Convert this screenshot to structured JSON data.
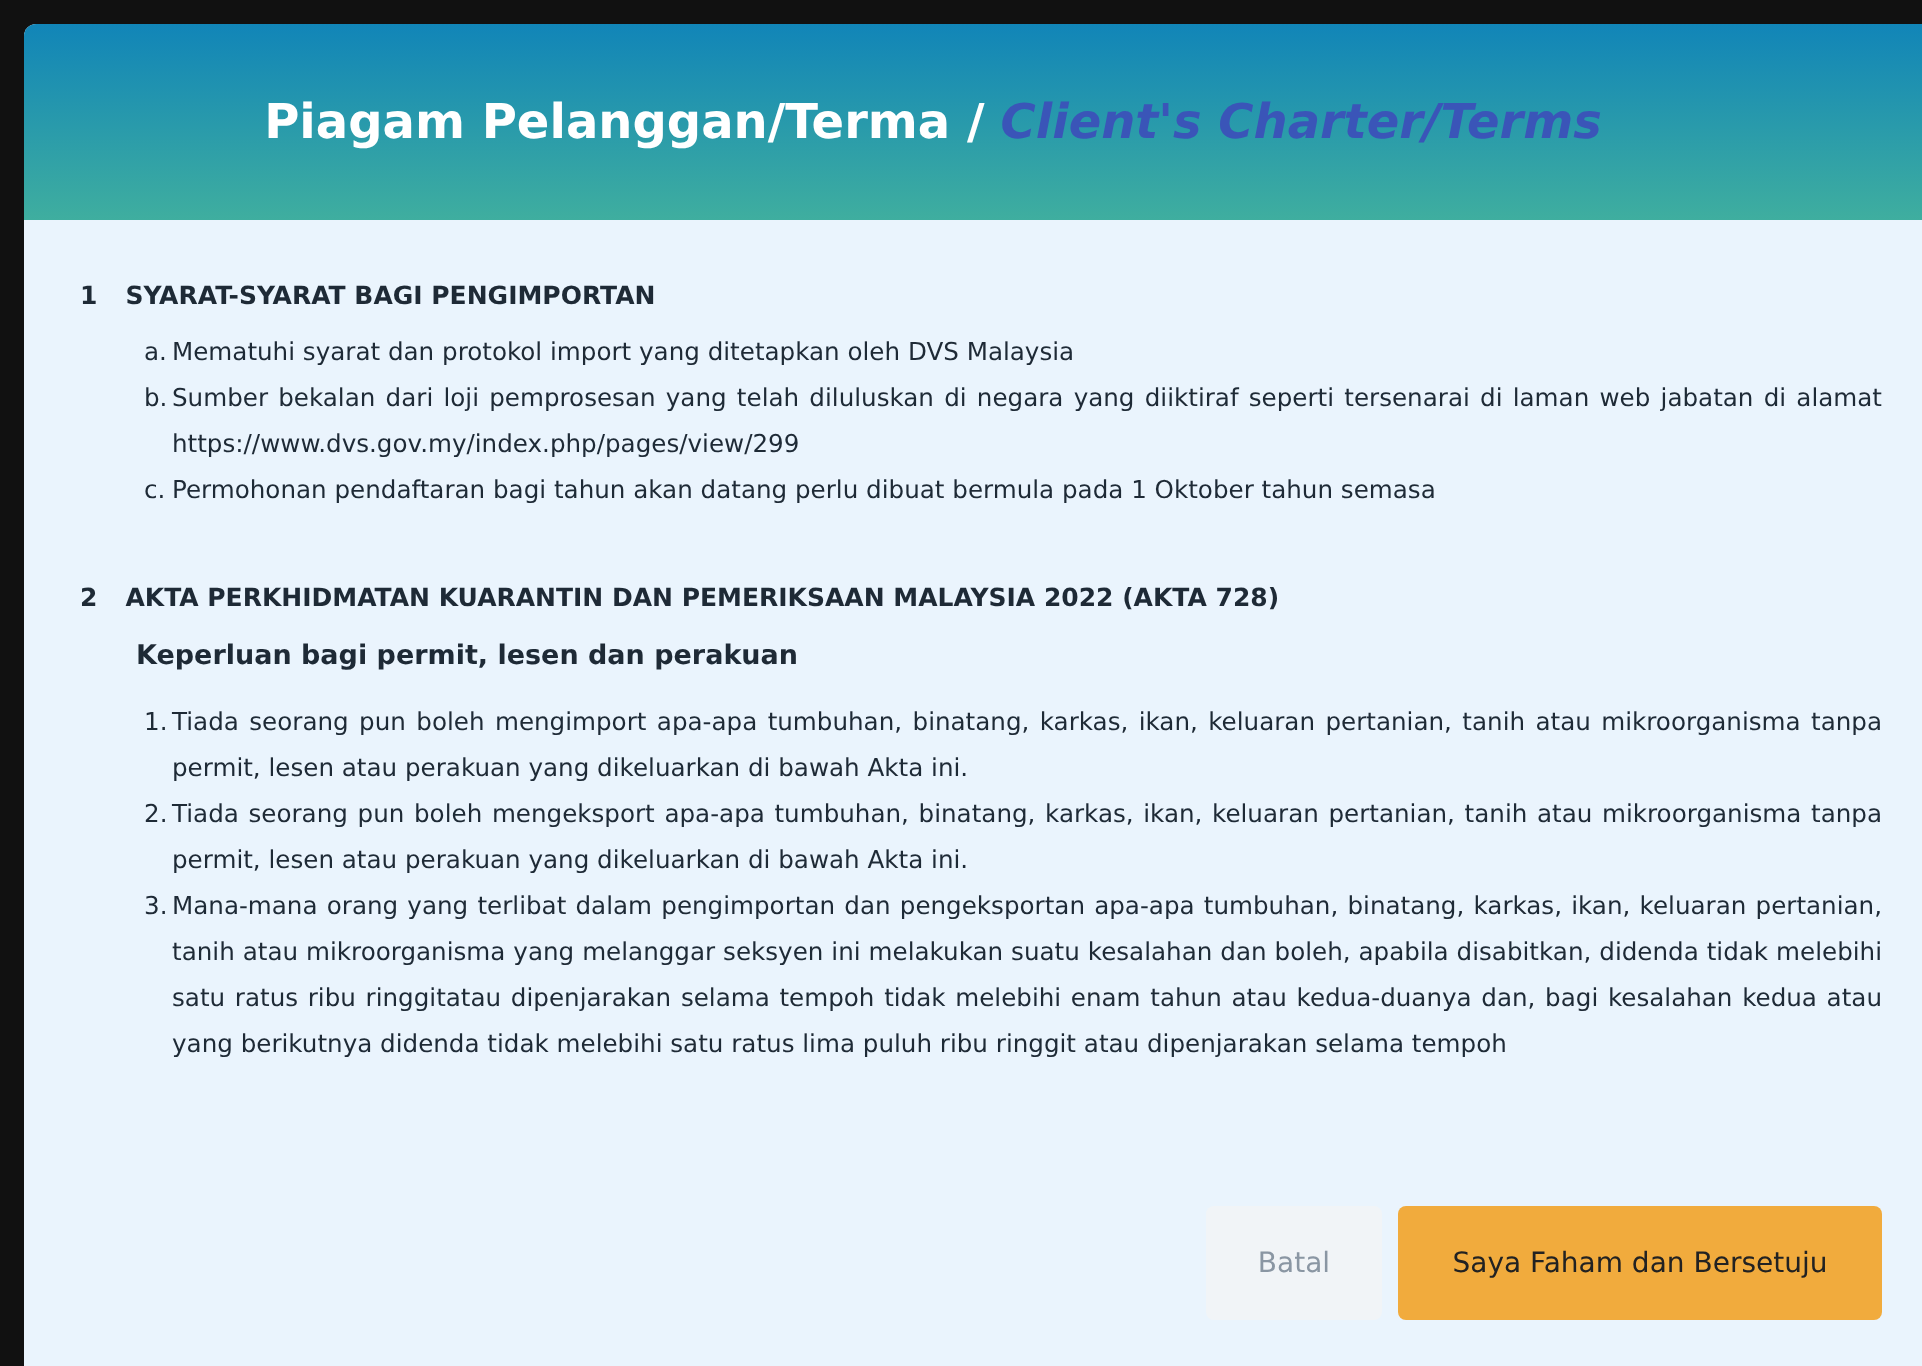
{
  "dialog": {
    "title": "Piagam Pelanggan/Terma /",
    "title_translation": "Client's Charter/Terms"
  },
  "sections": [
    {
      "number": "1",
      "heading": "SYARAT-SYARAT BAGI PENGIMPORTAN",
      "items": [
        {
          "marker": "a.",
          "text": "Mematuhi syarat dan protokol import yang ditetapkan oleh DVS Malaysia"
        },
        {
          "marker": "b.",
          "text": "Sumber bekalan dari loji pemprosesan yang telah diluluskan di negara yang diiktiraf seperti tersenarai di laman web jabatan di alamat https://www.dvs.gov.my/index.php/pages/view/299"
        },
        {
          "marker": "c.",
          "text": "Permohonan pendaftaran bagi tahun akan datang perlu dibuat bermula pada 1 Oktober tahun semasa"
        }
      ]
    },
    {
      "number": "2",
      "heading": "AKTA PERKHIDMATAN KUARANTIN DAN PEMERIKSAAN MALAYSIA 2022 (AKTA 728)",
      "subheading": "Keperluan bagi permit, lesen dan perakuan",
      "items": [
        {
          "marker": "1.",
          "text": "Tiada seorang pun boleh mengimport apa-apa tumbuhan, binatang, karkas, ikan, keluaran pertanian, tanih atau mikroorganisma tanpa permit, lesen atau perakuan yang dikeluarkan di bawah Akta ini."
        },
        {
          "marker": "2.",
          "text": "Tiada seorang pun boleh mengeksport apa-apa tumbuhan, binatang, karkas, ikan, keluaran pertanian, tanih atau mikroorganisma tanpa permit, lesen atau perakuan yang dikeluarkan di bawah Akta ini."
        },
        {
          "marker": "3.",
          "text": "Mana-mana orang yang terlibat dalam pengimportan dan pengeksportan apa-apa tumbuhan, binatang, karkas, ikan, keluaran pertanian, tanih atau mikroorganisma yang melanggar seksyen ini melakukan suatu kesalahan dan boleh, apabila disabitkan, didenda tidak melebihi satu ratus ribu ringgitatau dipenjarakan selama tempoh tidak melebihi enam tahun atau kedua-duanya dan, bagi kesalahan kedua atau yang berikutnya didenda tidak melebihi satu ratus lima puluh ribu ringgit atau dipenjarakan selama tempoh"
        }
      ]
    }
  ],
  "buttons": [
    {
      "label": "Batal",
      "kind": "secondary"
    },
    {
      "label": "Saya Faham dan Bersetuju",
      "kind": "primary"
    }
  ]
}
